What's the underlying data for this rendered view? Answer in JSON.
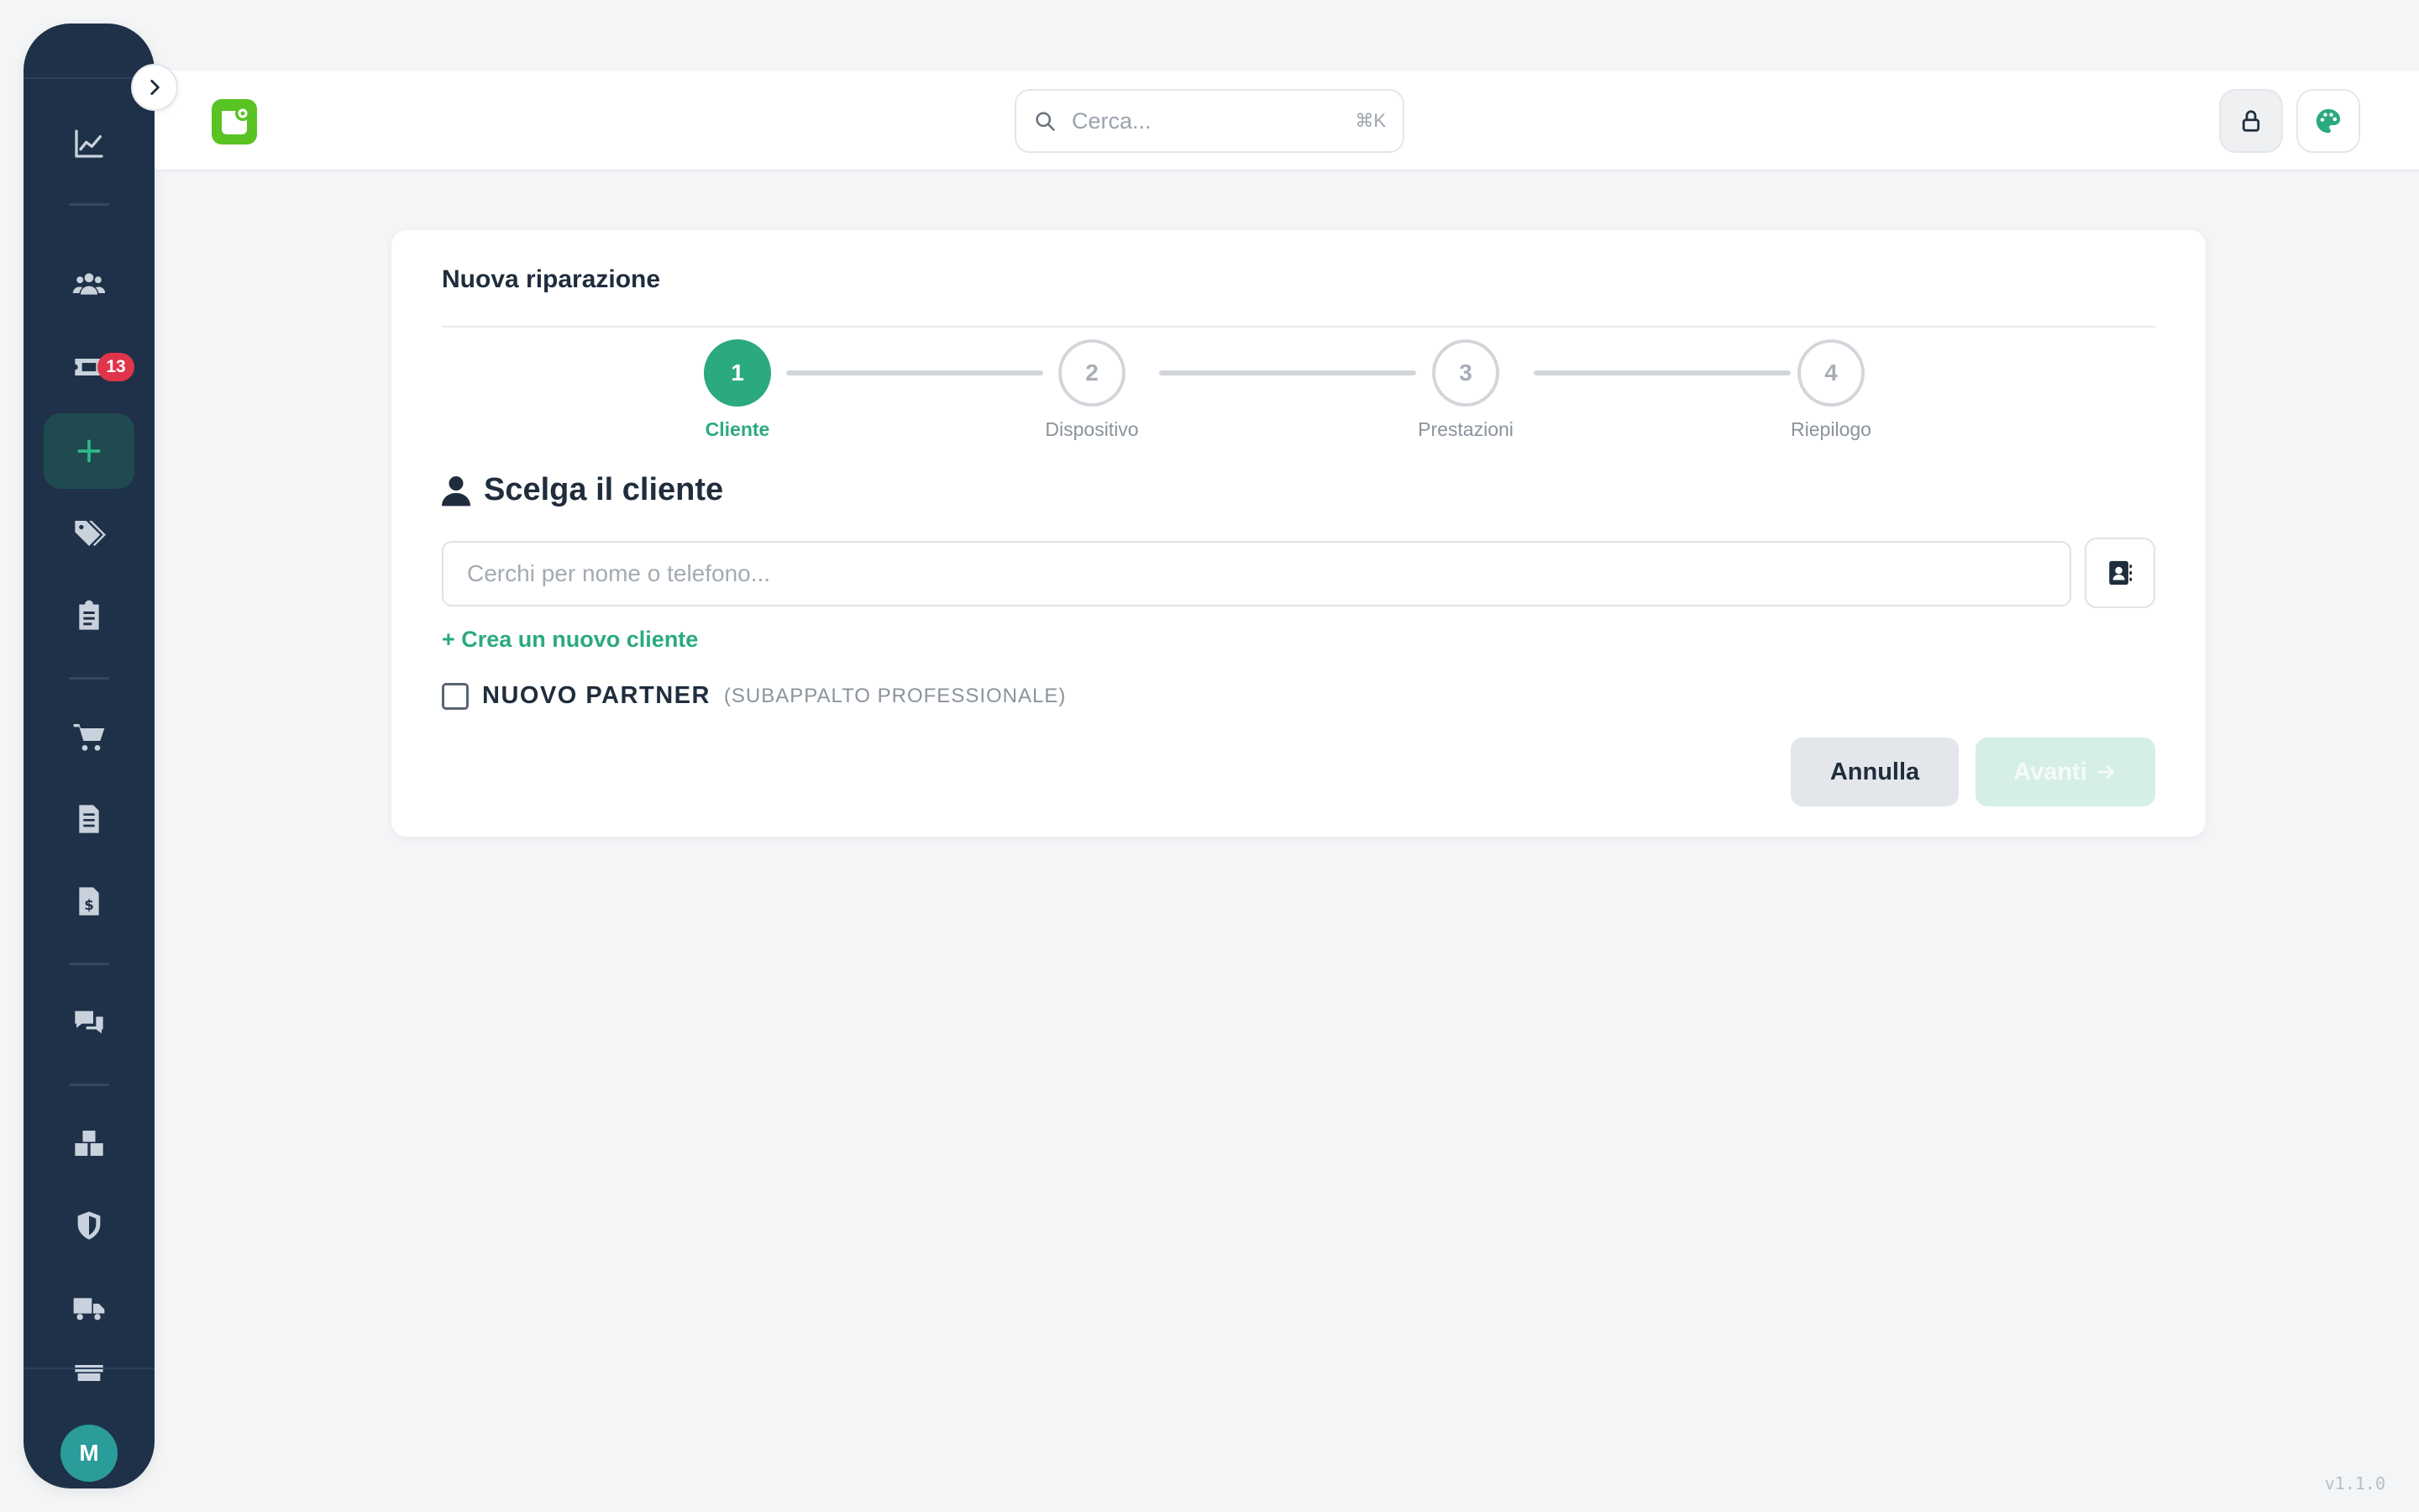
{
  "sidebar": {
    "tickets_badge": "13",
    "avatar_initial": "M"
  },
  "header": {
    "search_placeholder": "Cerca...",
    "search_shortcut": "⌘K"
  },
  "card": {
    "title": "Nuova riparazione",
    "steps": [
      {
        "number": "1",
        "label": "Cliente"
      },
      {
        "number": "2",
        "label": "Dispositivo"
      },
      {
        "number": "3",
        "label": "Prestazioni"
      },
      {
        "number": "4",
        "label": "Riepilogo"
      }
    ],
    "section_title": "Scelga il cliente",
    "customer_search_placeholder": "Cerchi per nome o telefono...",
    "create_customer_link": "+ Crea un nuovo cliente",
    "partner_label": "NUOVO PARTNER",
    "partner_sublabel": "(SUBAPPALTO PROFESSIONALE)",
    "cancel_label": "Annulla",
    "next_label": "Avanti"
  },
  "footer": {
    "version": "v1.1.0"
  },
  "colors": {
    "sidebar_bg": "#1e3149",
    "accent": "#2ba980",
    "badge": "#e0344b",
    "logo": "#58c322"
  }
}
